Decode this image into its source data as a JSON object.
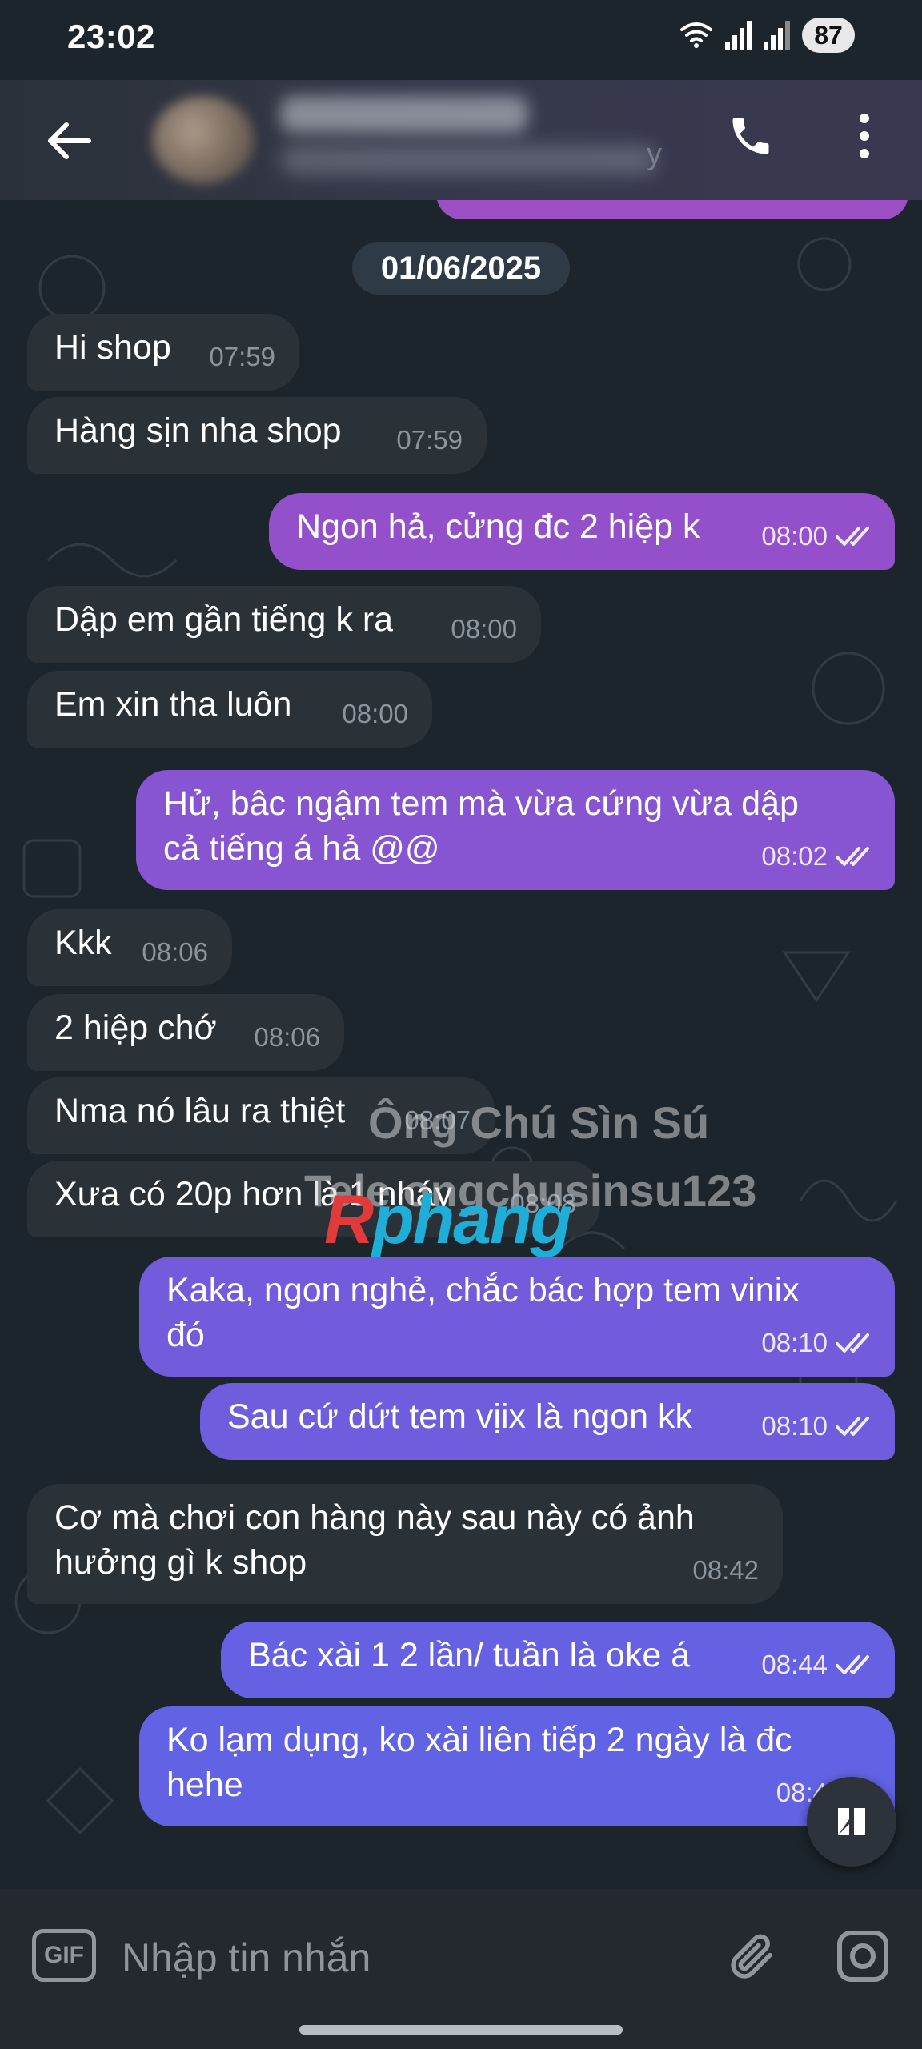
{
  "status_bar": {
    "time": "23:02",
    "battery": "87",
    "icons": [
      "wifi-icon",
      "signal-icon",
      "signal-icon-2",
      "battery-icon"
    ]
  },
  "header": {
    "contact_name": "",
    "contact_status_tail": "y",
    "icons": [
      "back-arrow-icon",
      "phone-icon",
      "more-vertical-icon"
    ]
  },
  "chat": {
    "date_separator": "01/06/2025",
    "messages": [
      {
        "dir": "in",
        "text": "Hi shop",
        "time": "07:59"
      },
      {
        "dir": "in",
        "text": "Hàng sịn nha shop",
        "time": "07:59"
      },
      {
        "dir": "out",
        "text": "Ngon hả, cửng đc 2 hiệp k",
        "time": "08:00"
      },
      {
        "dir": "in",
        "text": "Dập em gần tiếng k ra",
        "time": "08:00"
      },
      {
        "dir": "in",
        "text": "Em xin tha luôn",
        "time": "08:00"
      },
      {
        "dir": "out",
        "text": "Hử, bâc ngậm tem mà vừa cứng vừa dập\ncả tiếng á hả @@",
        "time": "08:02"
      },
      {
        "dir": "in",
        "text": "Kkk",
        "time": "08:06"
      },
      {
        "dir": "in",
        "text": "2 hiệp chớ",
        "time": "08:06"
      },
      {
        "dir": "in",
        "text": "Nma nó lâu ra thiệt",
        "time": "08:07"
      },
      {
        "dir": "in",
        "text": "Xưa có 20p hơn là 1 nháy",
        "time": "08:08"
      },
      {
        "dir": "out",
        "text": "Kaka, ngon nghẻ, chắc bác hợp tem vinix\nđó",
        "time": "08:10"
      },
      {
        "dir": "out",
        "text": "Sau cứ dứt tem vịix là ngon kk",
        "time": "08:10"
      },
      {
        "dir": "in",
        "text": "Cơ mà chơi con hàng này sau này có ảnh\nhưởng gì k shop",
        "time": "08:42"
      },
      {
        "dir": "out",
        "text": "Bác xài 1 2 lần/ tuần là oke á",
        "time": "08:44"
      },
      {
        "dir": "out",
        "text": "Ko lạm dụng, ko xài liên tiếp 2 ngày là đc\nhehe",
        "time": "08:4"
      }
    ]
  },
  "watermark": {
    "line1": "Ông Chú Sìn Sú",
    "line2": "Tele ongchusinsu123",
    "logo_first": "R",
    "logo_rest": "phang"
  },
  "input_bar": {
    "gif_label": "GIF",
    "placeholder": "Nhập tin nhắn"
  },
  "colors": {
    "incoming_bubble": "#2a3238",
    "outgoing_top": "#9a4fc4",
    "outgoing_bottom": "#6560e2",
    "background": "#1c252c"
  }
}
